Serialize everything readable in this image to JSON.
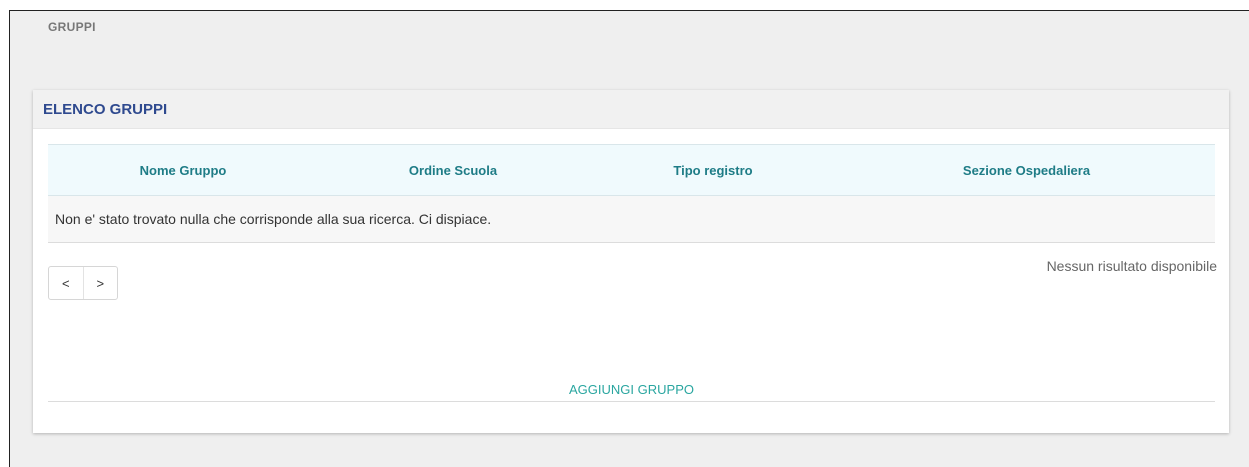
{
  "breadcrumb": "GRUPPI",
  "card": {
    "title": "ELENCO GRUPPI"
  },
  "table": {
    "headers": [
      "Nome Gruppo",
      "Ordine Scuola",
      "Tipo registro",
      "Sezione Ospedaliera"
    ],
    "empty_message": "Non e' stato trovato nulla che corrisponde alla sua ricerca. Ci dispiace."
  },
  "pagination": {
    "prev_label": "<",
    "next_label": ">",
    "status": "Nessun risultato disponibile"
  },
  "actions": {
    "add_label": "AGGIUNGI GRUPPO"
  },
  "colors": {
    "title": "#2f4a8f",
    "header_text": "#1e7c86",
    "header_bg": "#f0fafd",
    "action": "#2aa6a0"
  }
}
